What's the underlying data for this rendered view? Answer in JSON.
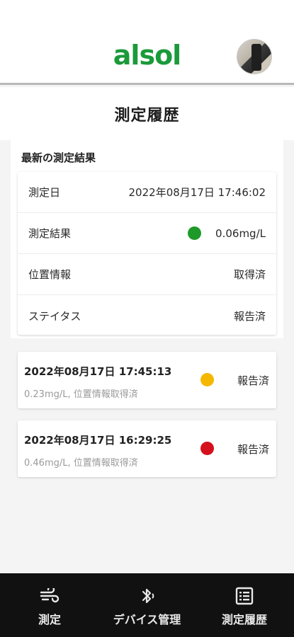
{
  "header": {
    "logo_text": "alsol",
    "avatar": "user-avatar"
  },
  "page_title": "測定履歴",
  "latest": {
    "heading": "最新の測定結果",
    "rows": [
      {
        "label": "測定日",
        "value": "2022年08月17日 17:46:02"
      },
      {
        "label": "測定結果",
        "value": "0.06mg/L",
        "indicator_color": "#1e9a28"
      },
      {
        "label": "位置情報",
        "value": "取得済"
      },
      {
        "label": "ステイタス",
        "value": "報告済"
      }
    ]
  },
  "history": [
    {
      "datetime": "2022年08月17日 17:45:13",
      "detail": "0.23mg/L, 位置情報取得済",
      "status": "報告済",
      "indicator_color": "#f5b800"
    },
    {
      "datetime": "2022年08月17日 16:29:25",
      "detail": "0.46mg/L, 位置情報取得済",
      "status": "報告済",
      "indicator_color": "#d4101c"
    }
  ],
  "nav": {
    "items": [
      {
        "label": "測定",
        "icon": "wind-icon"
      },
      {
        "label": "デバイス管理",
        "icon": "bluetooth-icon"
      },
      {
        "label": "測定履歴",
        "icon": "list-icon"
      }
    ]
  }
}
